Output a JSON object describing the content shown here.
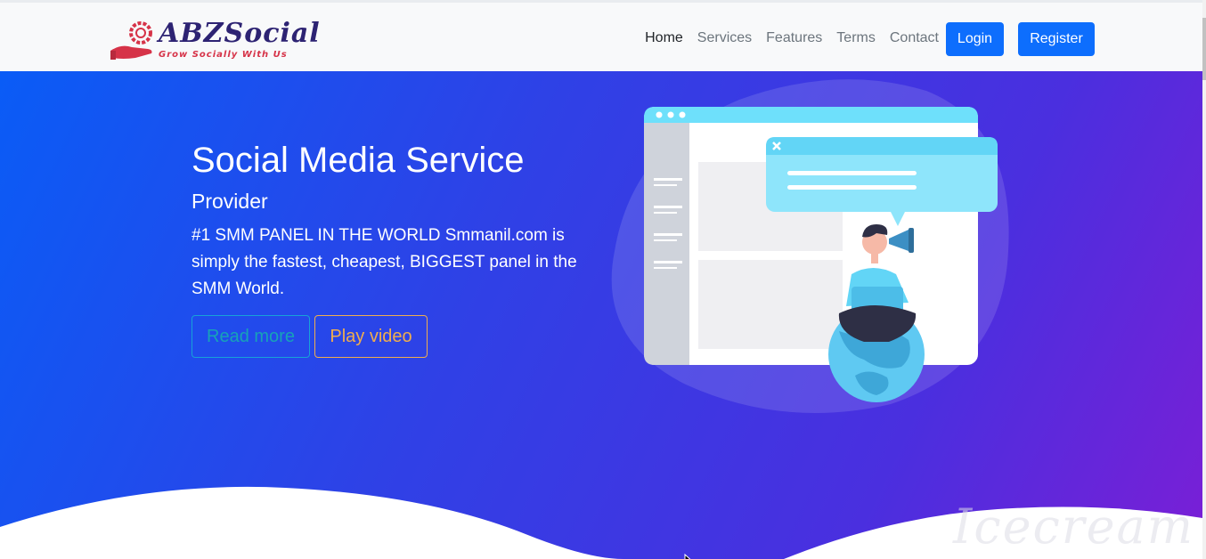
{
  "brand": {
    "name": "ABZSocial",
    "tagline": "Grow Socially With Us"
  },
  "nav": {
    "links": [
      "Home",
      "Services",
      "Features",
      "Terms",
      "Contact"
    ],
    "active": "Home",
    "login_label": "Login",
    "register_label": "Register"
  },
  "hero": {
    "title": "Social Media Service",
    "subtitle": "Provider",
    "description": "#1 SMM PANEL IN THE WORLD Smmanil.com is simply the fastest, cheapest, BIGGEST panel in the SMM World.",
    "read_more_label": "Read more",
    "play_video_label": "Play video"
  },
  "watermark": {
    "text": "Icecream"
  },
  "colors": {
    "primary": "#0d6efd",
    "hero_start": "#0a5cf6",
    "hero_end": "#7a1fd6",
    "read_more": "#17a2b8",
    "play_video": "#f0ad4e",
    "brand_text": "#2d2373",
    "brand_accent": "#d63348"
  },
  "icons": [
    "logo-hand-gear-icon",
    "close-icon",
    "megaphone-icon",
    "mouse-cursor-icon"
  ]
}
